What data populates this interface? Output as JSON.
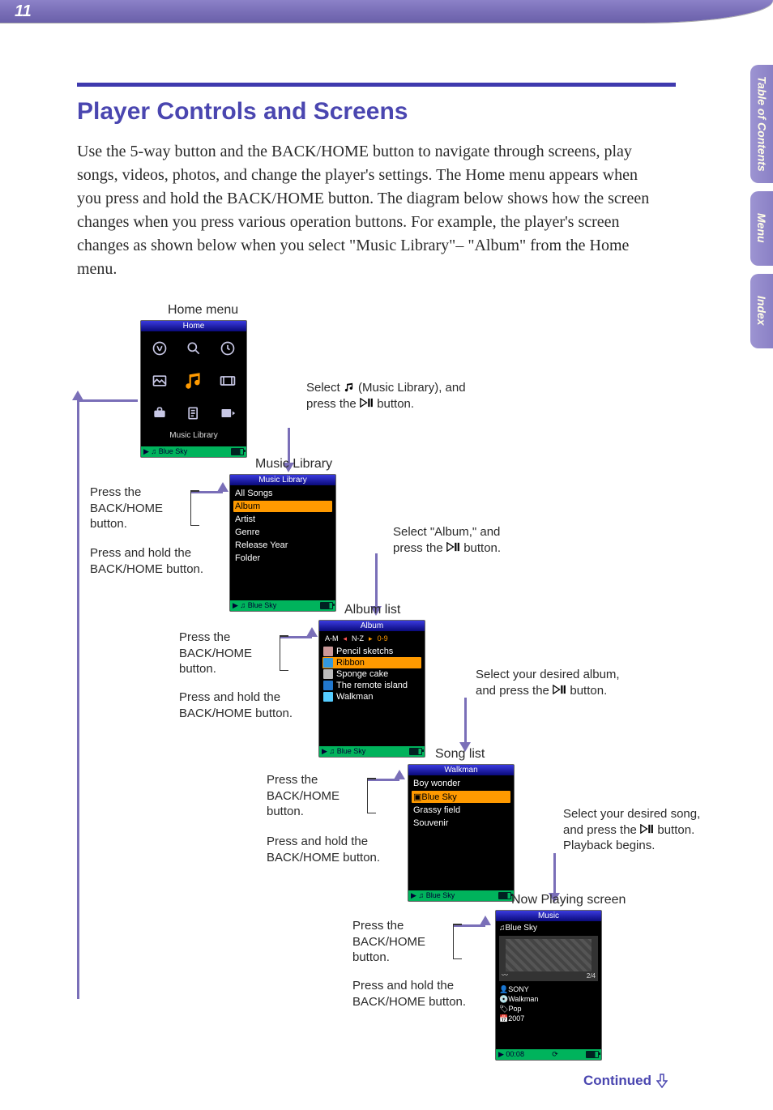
{
  "page_number": "11",
  "sidetabs": [
    {
      "label": "Table of\nContents"
    },
    {
      "label": "Menu"
    },
    {
      "label": "Index"
    }
  ],
  "heading": "Player Controls and Screens",
  "intro": "Use the 5-way button and the BACK/HOME button to navigate through screens, play songs, videos, photos, and change the player's settings. The Home menu appears when you press and hold the BACK/HOME button. The diagram below shows how the screen changes when you press various operation buttons. For example, the player's screen changes as shown below when you select \"Music Library\"– \"Album\" from the Home menu.",
  "continued": "Continued",
  "labels": {
    "home_menu": "Home menu",
    "music_library": "Music Library",
    "album_list": "Album list",
    "song_list": "Song list",
    "now_playing": "Now Playing screen",
    "press_back": "Press the BACK/HOME button.",
    "press_hold": "Press and hold the BACK/HOME button.",
    "step1_a": "Select ",
    "step1_b": " (Music Library), and press the ",
    "step1_c": " button.",
    "step2_a": "Select \"Album,\" and press the ",
    "step2_b": " button.",
    "step3_a": "Select your desired album, and press the ",
    "step3_b": " button.",
    "step4_a": "Select your desired song, and press the ",
    "step4_b": " button. Playback begins."
  },
  "status_song": "Blue Sky",
  "screens": {
    "home": {
      "title": "Home",
      "selected_label": "Music Library",
      "icons": [
        "intelligent-shuffle-icon",
        "search-icon",
        "clock-icon",
        "photo-icon",
        "music-icon",
        "video-icon",
        "settings-icon",
        "playlist-icon",
        "now-playing-icon"
      ]
    },
    "library": {
      "title": "Music Library",
      "items": [
        "All Songs",
        "Album",
        "Artist",
        "Genre",
        "Release Year",
        "Folder"
      ],
      "selected": 1
    },
    "albums": {
      "title": "Album",
      "alpha": {
        "left": "A-M",
        "mid": "N-Z",
        "right": "0-9"
      },
      "items": [
        {
          "name": "Pencil sketchs",
          "color": "#c99"
        },
        {
          "name": "Ribbon",
          "color": "#39d",
          "sel": true
        },
        {
          "name": "Sponge cake",
          "color": "#bbb"
        },
        {
          "name": "The remote island",
          "color": "#27c"
        },
        {
          "name": "Walkman",
          "color": "#5cf"
        }
      ]
    },
    "songs": {
      "title": "Walkman",
      "items": [
        "Boy wonder",
        "Blue Sky",
        "Grassy field",
        "Souvenir"
      ],
      "selected": 1
    },
    "nowplaying": {
      "title": "Music",
      "song": "Blue Sky",
      "track": "2/4",
      "artist": "SONY",
      "album": "Walkman",
      "genre": "Pop",
      "year": "2007",
      "elapsed": "00:08"
    }
  }
}
